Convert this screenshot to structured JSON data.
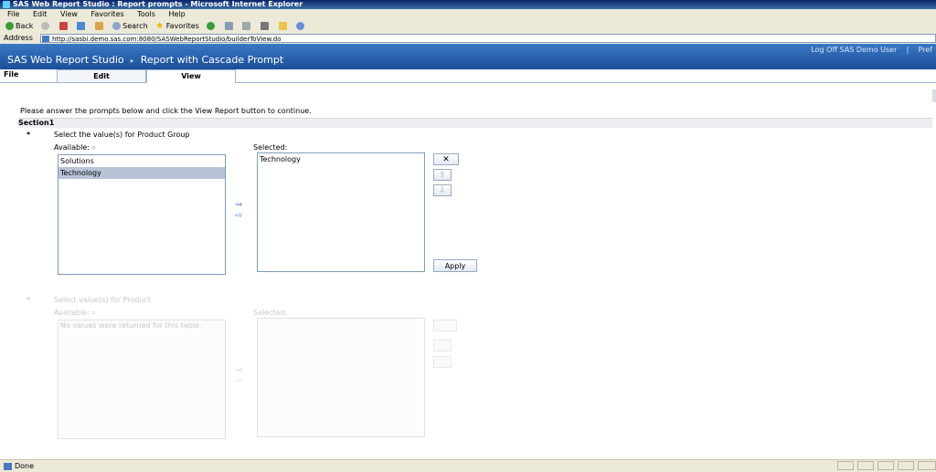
{
  "window": {
    "title": "SAS Web Report Studio : Report prompts - Microsoft Internet Explorer",
    "menu": [
      "File",
      "Edit",
      "View",
      "Favorites",
      "Tools",
      "Help"
    ],
    "toolbar": {
      "back": "Back",
      "search": "Search",
      "favorites": "Favorites"
    },
    "address_label": "Address",
    "address_url": "http://sasbi.demo.sas.com:8080/SASWebReportStudio/builderToView.do",
    "status": "Done"
  },
  "app": {
    "name": "SAS Web Report Studio",
    "separator": "▸",
    "report_name": "Report with Cascade Prompt",
    "logoff": "Log Off SAS Demo User",
    "link_divider": "|",
    "preferences": "Pref",
    "menu_file": "File",
    "tabs": [
      "Edit",
      "View"
    ]
  },
  "prompts": {
    "instructions": "Please answer the prompts below and click the View Report button to continue.",
    "section_title": "Section1",
    "required_marker": "*",
    "prompt1": {
      "label": "Select the value(s) for Product Group",
      "available_label": "Available:",
      "selected_label": "Selected:",
      "available": [
        "Solutions",
        "Technology"
      ],
      "selected_available_index": 1,
      "selected": [
        "Technology"
      ],
      "remove_icon": "✕",
      "up_icon": "⇧",
      "down_icon": "⇩",
      "apply_label": "Apply"
    },
    "prompt2": {
      "label": "Select value(s) for Product",
      "available_label": "Available:",
      "selected_label": "Selected:",
      "empty_message": "No values were returned for this table."
    },
    "add_arrow": "⇒",
    "move_arrow": "⇨"
  },
  "colors": {
    "banner": "#2a64b4",
    "selection": "#b8c4d6"
  }
}
